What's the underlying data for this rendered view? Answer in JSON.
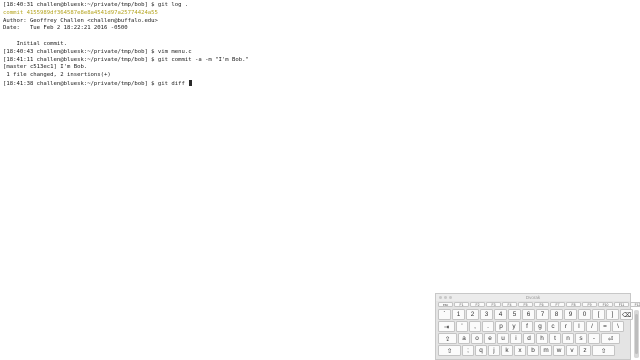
{
  "terminal": {
    "lines": [
      "[18:40:31 challen@bluesk:~/private/tmp/bob] $ git log .",
      "commit 4155989df364587e8e8a4541d97a25774424a55",
      "Author: Geoffrey Challen <challen@buffalo.edu>",
      "Date:   Tue Feb 2 18:22:21 2016 -0500",
      "",
      "    Initial commit.",
      "[18:40:43 challen@bluesk:~/private/tmp/bob] $ vim menu.c",
      "[18:41:11 challen@bluesk:~/private/tmp/bob] $ git commit -a -m \"I'm Bob.\"",
      "[master c513ec1] I'm Bob.",
      " 1 file changed, 2 insertions(+)",
      "[18:41:38 challen@bluesk:~/private/tmp/bob] $ git diff "
    ],
    "line_colors": [
      "default",
      "commit-yellow",
      "default",
      "default",
      "default",
      "default",
      "default",
      "default",
      "default",
      "default",
      "default"
    ],
    "colors": {
      "background": "#ffffff",
      "text": "#1a1a1a",
      "commit-yellow": "#b3a21a"
    }
  },
  "keyboard": {
    "title": "Dvorak",
    "rows": [
      [
        "esc",
        "F1",
        "F2",
        "F3",
        "F4",
        "F5",
        "F6",
        "F7",
        "F8",
        "F9",
        "F10",
        "F11",
        "F12"
      ],
      [
        "`",
        "1",
        "2",
        "3",
        "4",
        "5",
        "6",
        "7",
        "8",
        "9",
        "0",
        "[",
        "]",
        "⌫"
      ],
      [
        "⇥",
        "'",
        ",",
        ".",
        "p",
        "y",
        "f",
        "g",
        "c",
        "r",
        "l",
        "/",
        "=",
        "\\"
      ],
      [
        "⇪",
        "a",
        "o",
        "e",
        "u",
        "i",
        "d",
        "h",
        "t",
        "n",
        "s",
        "-",
        "⏎"
      ],
      [
        "⇧",
        ";",
        "q",
        "j",
        "k",
        "x",
        "b",
        "m",
        "w",
        "v",
        "z",
        "⇧"
      ]
    ]
  }
}
